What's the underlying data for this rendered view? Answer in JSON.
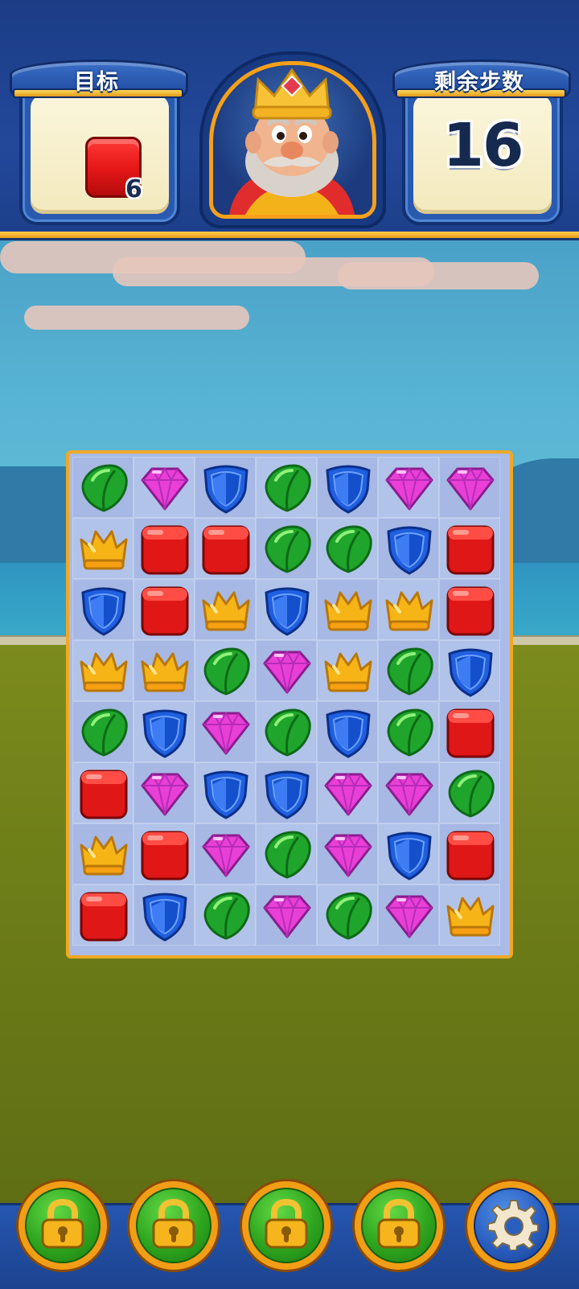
{
  "header": {
    "target_label": "目标",
    "target_remaining": "6",
    "target_item_icon": "red-block-icon",
    "moves_label": "剩余步数",
    "moves_value": "16",
    "portrait_icon": "king-portrait-icon"
  },
  "board": {
    "rows": 8,
    "cols": 7,
    "grid": [
      [
        "leaf",
        "gem",
        "shield",
        "leaf",
        "shield",
        "gem",
        "gem"
      ],
      [
        "crown",
        "cube",
        "cube",
        "leaf",
        "leaf",
        "shield",
        "cube"
      ],
      [
        "shield",
        "cube",
        "crown",
        "shield",
        "crown",
        "crown",
        "cube"
      ],
      [
        "crown",
        "crown",
        "leaf",
        "gem",
        "crown",
        "leaf",
        "shield"
      ],
      [
        "leaf",
        "shield",
        "gem",
        "leaf",
        "shield",
        "leaf",
        "cube"
      ],
      [
        "cube",
        "gem",
        "shield",
        "shield",
        "gem",
        "gem",
        "leaf"
      ],
      [
        "crown",
        "cube",
        "gem",
        "leaf",
        "gem",
        "shield",
        "cube"
      ],
      [
        "cube",
        "shield",
        "leaf",
        "gem",
        "leaf",
        "gem",
        "crown"
      ]
    ]
  },
  "bottom_bar": {
    "items": [
      {
        "name": "locked-booster-1",
        "icon": "padlock-icon"
      },
      {
        "name": "locked-booster-2",
        "icon": "padlock-icon"
      },
      {
        "name": "locked-booster-3",
        "icon": "padlock-icon"
      },
      {
        "name": "locked-booster-4",
        "icon": "padlock-icon"
      },
      {
        "name": "settings-button",
        "icon": "gear-icon"
      }
    ]
  },
  "colors": {
    "leaf": "#1fa52b",
    "gem": "#e93fd6",
    "shield": "#1f5fe0",
    "crown": "#f6b417",
    "cube": "#e01717",
    "board_frame": "#f0a823",
    "header_blue": "#1e3f87"
  }
}
